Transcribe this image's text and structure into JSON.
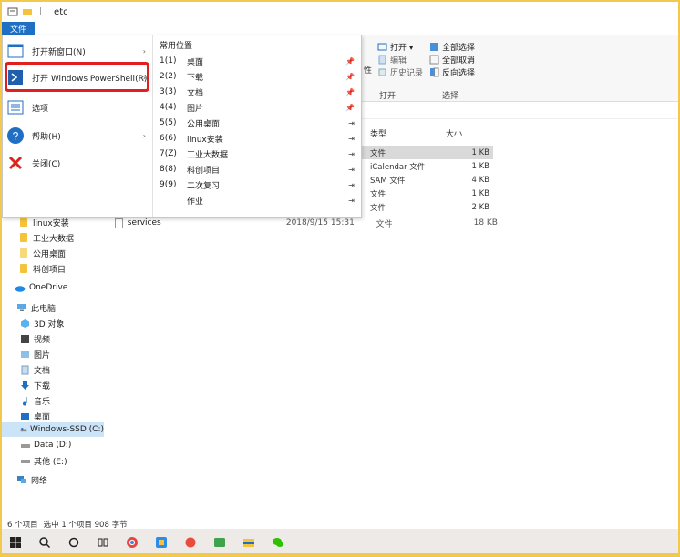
{
  "window": {
    "title": "etc",
    "title_sep": "|",
    "file_tab": "文件"
  },
  "file_menu": {
    "items": [
      {
        "label": "打开新窗口(N)",
        "has_arrow": true
      },
      {
        "label": "打开 Windows PowerShell(R)",
        "has_arrow": true
      },
      {
        "label": "选项",
        "has_arrow": false
      },
      {
        "label": "帮助(H)",
        "has_arrow": true
      },
      {
        "label": "关闭(C)",
        "has_arrow": false
      }
    ],
    "arrow": "›",
    "recent_title": "常用位置",
    "recent": [
      {
        "num": "1(1)",
        "name": "桌面",
        "pin": "📌"
      },
      {
        "num": "2(2)",
        "name": "下载",
        "pin": "📌"
      },
      {
        "num": "3(3)",
        "name": "文档",
        "pin": "📌"
      },
      {
        "num": "4(4)",
        "name": "图片",
        "pin": "📌"
      },
      {
        "num": "5(5)",
        "name": "公用桌面",
        "pin": "⇥"
      },
      {
        "num": "6(6)",
        "name": "linux安装",
        "pin": "⇥"
      },
      {
        "num": "7(Z)",
        "name": "工业大数据",
        "pin": "⇥"
      },
      {
        "num": "8(8)",
        "name": "科创项目",
        "pin": "⇥"
      },
      {
        "num": "9(9)",
        "name": "二次复习",
        "pin": "⇥"
      },
      {
        "num": "",
        "name": "作业",
        "pin": "⇥"
      }
    ]
  },
  "ribbon": {
    "open_label": "打开",
    "open_drop": "打开 ▾",
    "edit": "编辑",
    "history": "历史记录",
    "select_label": "选择",
    "select_all": "全部选择",
    "select_none": "全部取消",
    "invert": "反向选择",
    "partial": "性"
  },
  "columns": {
    "type": "类型",
    "size": "大小"
  },
  "files": [
    {
      "type": "文件",
      "size": "1 KB",
      "selected": true
    },
    {
      "type": "iCalendar 文件",
      "size": "1 KB",
      "selected": false
    },
    {
      "type": "SAM 文件",
      "size": "4 KB",
      "selected": false
    },
    {
      "type": "文件",
      "size": "1 KB",
      "selected": false
    },
    {
      "type": "文件",
      "size": "2 KB",
      "selected": false
    }
  ],
  "services": {
    "name": "services",
    "date": "2018/9/15 15:31",
    "type": "文件",
    "size": "18 KB"
  },
  "nav": {
    "items": [
      {
        "label": "linux安装",
        "icon": "folder-icon"
      },
      {
        "label": "工业大数据",
        "icon": "folder-icon"
      },
      {
        "label": "公用桌面",
        "icon": "folder-icon"
      },
      {
        "label": "科创项目",
        "icon": "folder-icon"
      },
      {
        "label": "OneDrive",
        "icon": "cloud-icon"
      },
      {
        "label": "此电脑",
        "icon": "pc-icon"
      },
      {
        "label": "3D 对象",
        "icon": "cube-icon"
      },
      {
        "label": "视频",
        "icon": "video-icon"
      },
      {
        "label": "图片",
        "icon": "picture-icon"
      },
      {
        "label": "文档",
        "icon": "document-icon"
      },
      {
        "label": "下载",
        "icon": "download-icon"
      },
      {
        "label": "音乐",
        "icon": "music-icon"
      },
      {
        "label": "桌面",
        "icon": "desktop-icon"
      },
      {
        "label": "Windows-SSD (C:)",
        "icon": "drive-icon"
      },
      {
        "label": "Data (D:)",
        "icon": "drive-icon"
      },
      {
        "label": "其他 (E:)",
        "icon": "drive-icon"
      },
      {
        "label": "网络",
        "icon": "network-icon"
      }
    ]
  },
  "status": {
    "count": "6 个项目",
    "selection": "选中 1 个项目  908 字节"
  },
  "colors": {
    "accent": "#1f6fc5",
    "highlight": "#e02020",
    "frame": "#f2c94c"
  }
}
